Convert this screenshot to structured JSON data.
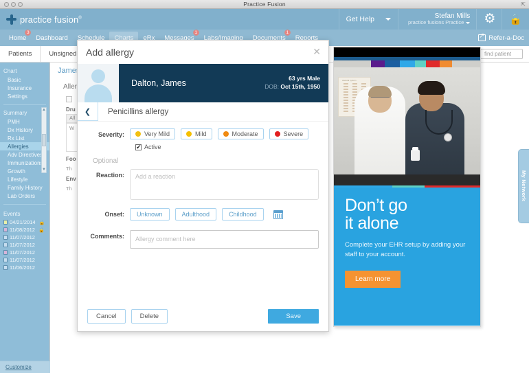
{
  "window": {
    "title": "Practice Fusion",
    "expand_icon": "expand-icon"
  },
  "header": {
    "brand": "practice fusion",
    "brand_sup": "®",
    "get_help": "Get Help",
    "user_name": "Stefan Mills",
    "user_practice": "practice fusions Practice",
    "gear_icon": "gear-icon",
    "lock_icon": "lock-icon"
  },
  "nav": {
    "items": [
      {
        "label": "Home",
        "badge": "3",
        "active": false
      },
      {
        "label": "Dashboard",
        "badge": "",
        "active": false
      },
      {
        "label": "Schedule",
        "badge": "",
        "active": false
      },
      {
        "label": "Charts",
        "badge": "",
        "active": true
      },
      {
        "label": "eRx",
        "badge": "",
        "active": false
      },
      {
        "label": "Messages",
        "badge": "1",
        "active": false
      },
      {
        "label": "Labs/Imaging",
        "badge": "",
        "active": false
      },
      {
        "label": "Documents",
        "badge": "1",
        "active": false
      },
      {
        "label": "Reports",
        "badge": "",
        "active": false
      }
    ],
    "refer_label": "Refer-a-Doc"
  },
  "tabstrip": {
    "tabs": [
      "Patients",
      "Unsigned"
    ],
    "find_patient_placeholder": "find patient"
  },
  "sidebar": {
    "chart_head": "Chart",
    "chart_items": [
      "Basic",
      "Insurance",
      "Settings"
    ],
    "summary_head": "Summary",
    "summary_items": [
      "PMH",
      "Dx History",
      "Rx List",
      "Allergies",
      "Adv Directives",
      "Immunizations",
      "Growth",
      "Lifestyle",
      "Family History",
      "Lab Orders"
    ],
    "selected_item": "Allergies",
    "events_head": "Events",
    "events": [
      {
        "date": "04/21/2014",
        "color": "#e8efa8",
        "locked": true
      },
      {
        "date": "11/08/2012",
        "color": "#d6b4d8",
        "locked": true
      },
      {
        "date": "11/07/2012",
        "color": "#c6ddef",
        "locked": false
      },
      {
        "date": "11/07/2012",
        "color": "#c6ddef",
        "locked": false
      },
      {
        "date": "11/07/2012",
        "color": "#d6b4d8",
        "locked": false
      },
      {
        "date": "11/07/2012",
        "color": "#c6ddef",
        "locked": false
      },
      {
        "date": "11/06/2012",
        "color": "#c6ddef",
        "locked": false
      }
    ],
    "customize": "Customize"
  },
  "content": {
    "patient_name": "James",
    "section_title": "Allerg",
    "drug_label": "Dru",
    "drug_value": "All",
    "drug_note": "W",
    "food_label": "Foo",
    "food_note": "Th",
    "env_label": "Env",
    "env_note": "Th",
    "my_network": "My Network"
  },
  "promo": {
    "heading_line1": "Don’t go",
    "heading_line2": "it alone",
    "body": "Complete your EHR setup by adding your staff to your account.",
    "button": "Learn more",
    "chip_colors": [
      "#5a1b8c",
      "#1b5ea0",
      "#2fa8e8",
      "#5fd0c4",
      "#e02a2a",
      "#f08b30"
    ],
    "accent_colors": [
      "#2fa8e8",
      "#5fd0c4",
      "#e02a2a"
    ],
    "bg_color": "#29a3e0",
    "button_color": "#f59331"
  },
  "modal": {
    "title": "Add allergy",
    "close_icon": "close-icon",
    "patient": {
      "name": "Dalton, James",
      "age_sex": "63 yrs Male",
      "dob_label": "DOB:",
      "dob_value": "Oct 15th, 1950"
    },
    "back_icon": "chevron-left-icon",
    "allergy_title": "Penicillins allergy",
    "severity_label": "Severity:",
    "severity_options": [
      {
        "label": "Very Mild",
        "color": "#f0c game",
        "dot": "#f2c012"
      },
      {
        "label": "Mild",
        "dot": "#f5c000"
      },
      {
        "label": "Moderate",
        "dot": "#f08a12"
      },
      {
        "label": "Severe",
        "dot": "#e32020"
      }
    ],
    "active_label": "Active",
    "active_checked": true,
    "optional_label": "Optional",
    "reaction_label": "Reaction:",
    "reaction_placeholder": "Add a reaction",
    "reaction_value": "",
    "onset_label": "Onset:",
    "onset_options": [
      "Unknown",
      "Adulthood",
      "Childhood"
    ],
    "calendar_icon": "calendar-icon",
    "comments_label": "Comments:",
    "comments_placeholder": "Allergy comment here",
    "comments_value": "",
    "cancel_label": "Cancel",
    "delete_label": "Delete",
    "save_label": "Save"
  }
}
